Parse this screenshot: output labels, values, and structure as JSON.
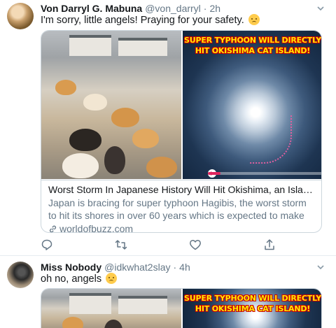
{
  "tweets": [
    {
      "author_name": "Von Darryl G. Mabuna",
      "handle": "@von_darryl",
      "separator": "·",
      "time": "2h",
      "text": "I'm sorry, little angels! Praying for your safety.",
      "emoji": "disappointed-face",
      "card": {
        "image_banner": "SUPER TYPHOON WILL DIRECTLY HIT OKISHIMA CAT ISLAND!",
        "title": "Worst Storm In Japanese History Will Hit Okishima, an Island Inhabite...",
        "description": "Japan is bracing for super typhoon Hagibis, the worst storm to hit its shores in over 60 years which is expected to make landfall today and ...",
        "domain": "worldofbuzz.com"
      },
      "actions": [
        "reply-icon",
        "retweet-icon",
        "like-icon",
        "share-icon"
      ]
    },
    {
      "author_name": "Miss Nobody",
      "handle": "@idkwhat2slay",
      "separator": "·",
      "time": "4h",
      "text": "oh no, angels",
      "emoji": "worried-face",
      "card": {
        "image_banner": "SUPER TYPHOON WILL DIRECTLY HIT OKISHIMA CAT ISLAND!"
      }
    }
  ],
  "colors": {
    "text_primary": "#14171a",
    "text_secondary": "#657786",
    "border": "#ccd6dd",
    "banner_text": "#ffea00",
    "banner_outline": "#cc0000"
  }
}
